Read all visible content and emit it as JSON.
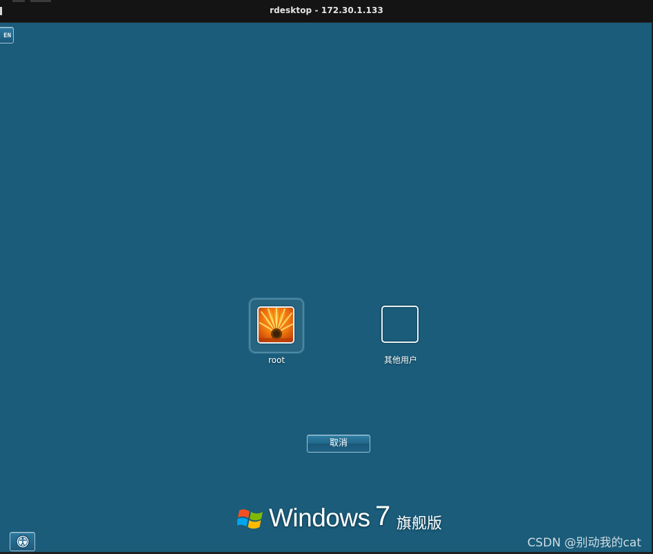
{
  "window": {
    "title": "rdesktop - 172.30.1.133"
  },
  "language_indicator": {
    "label": "EN"
  },
  "users": [
    {
      "name": "root",
      "avatar": "orange-flower-image",
      "selected": true
    },
    {
      "name": "其他用户",
      "avatar": "blank-tile",
      "selected": false
    }
  ],
  "buttons": {
    "cancel_label": "取消",
    "ease_of_access_icon": "ease-of-access-icon"
  },
  "branding": {
    "product_word": "Windows",
    "version": "7",
    "edition": "旗舰版"
  },
  "watermark": "CSDN @别动我的cat",
  "colors": {
    "desktop_background": "#1a5c7a",
    "titlebar": "#141414",
    "button_border": "#9dc3d6"
  }
}
